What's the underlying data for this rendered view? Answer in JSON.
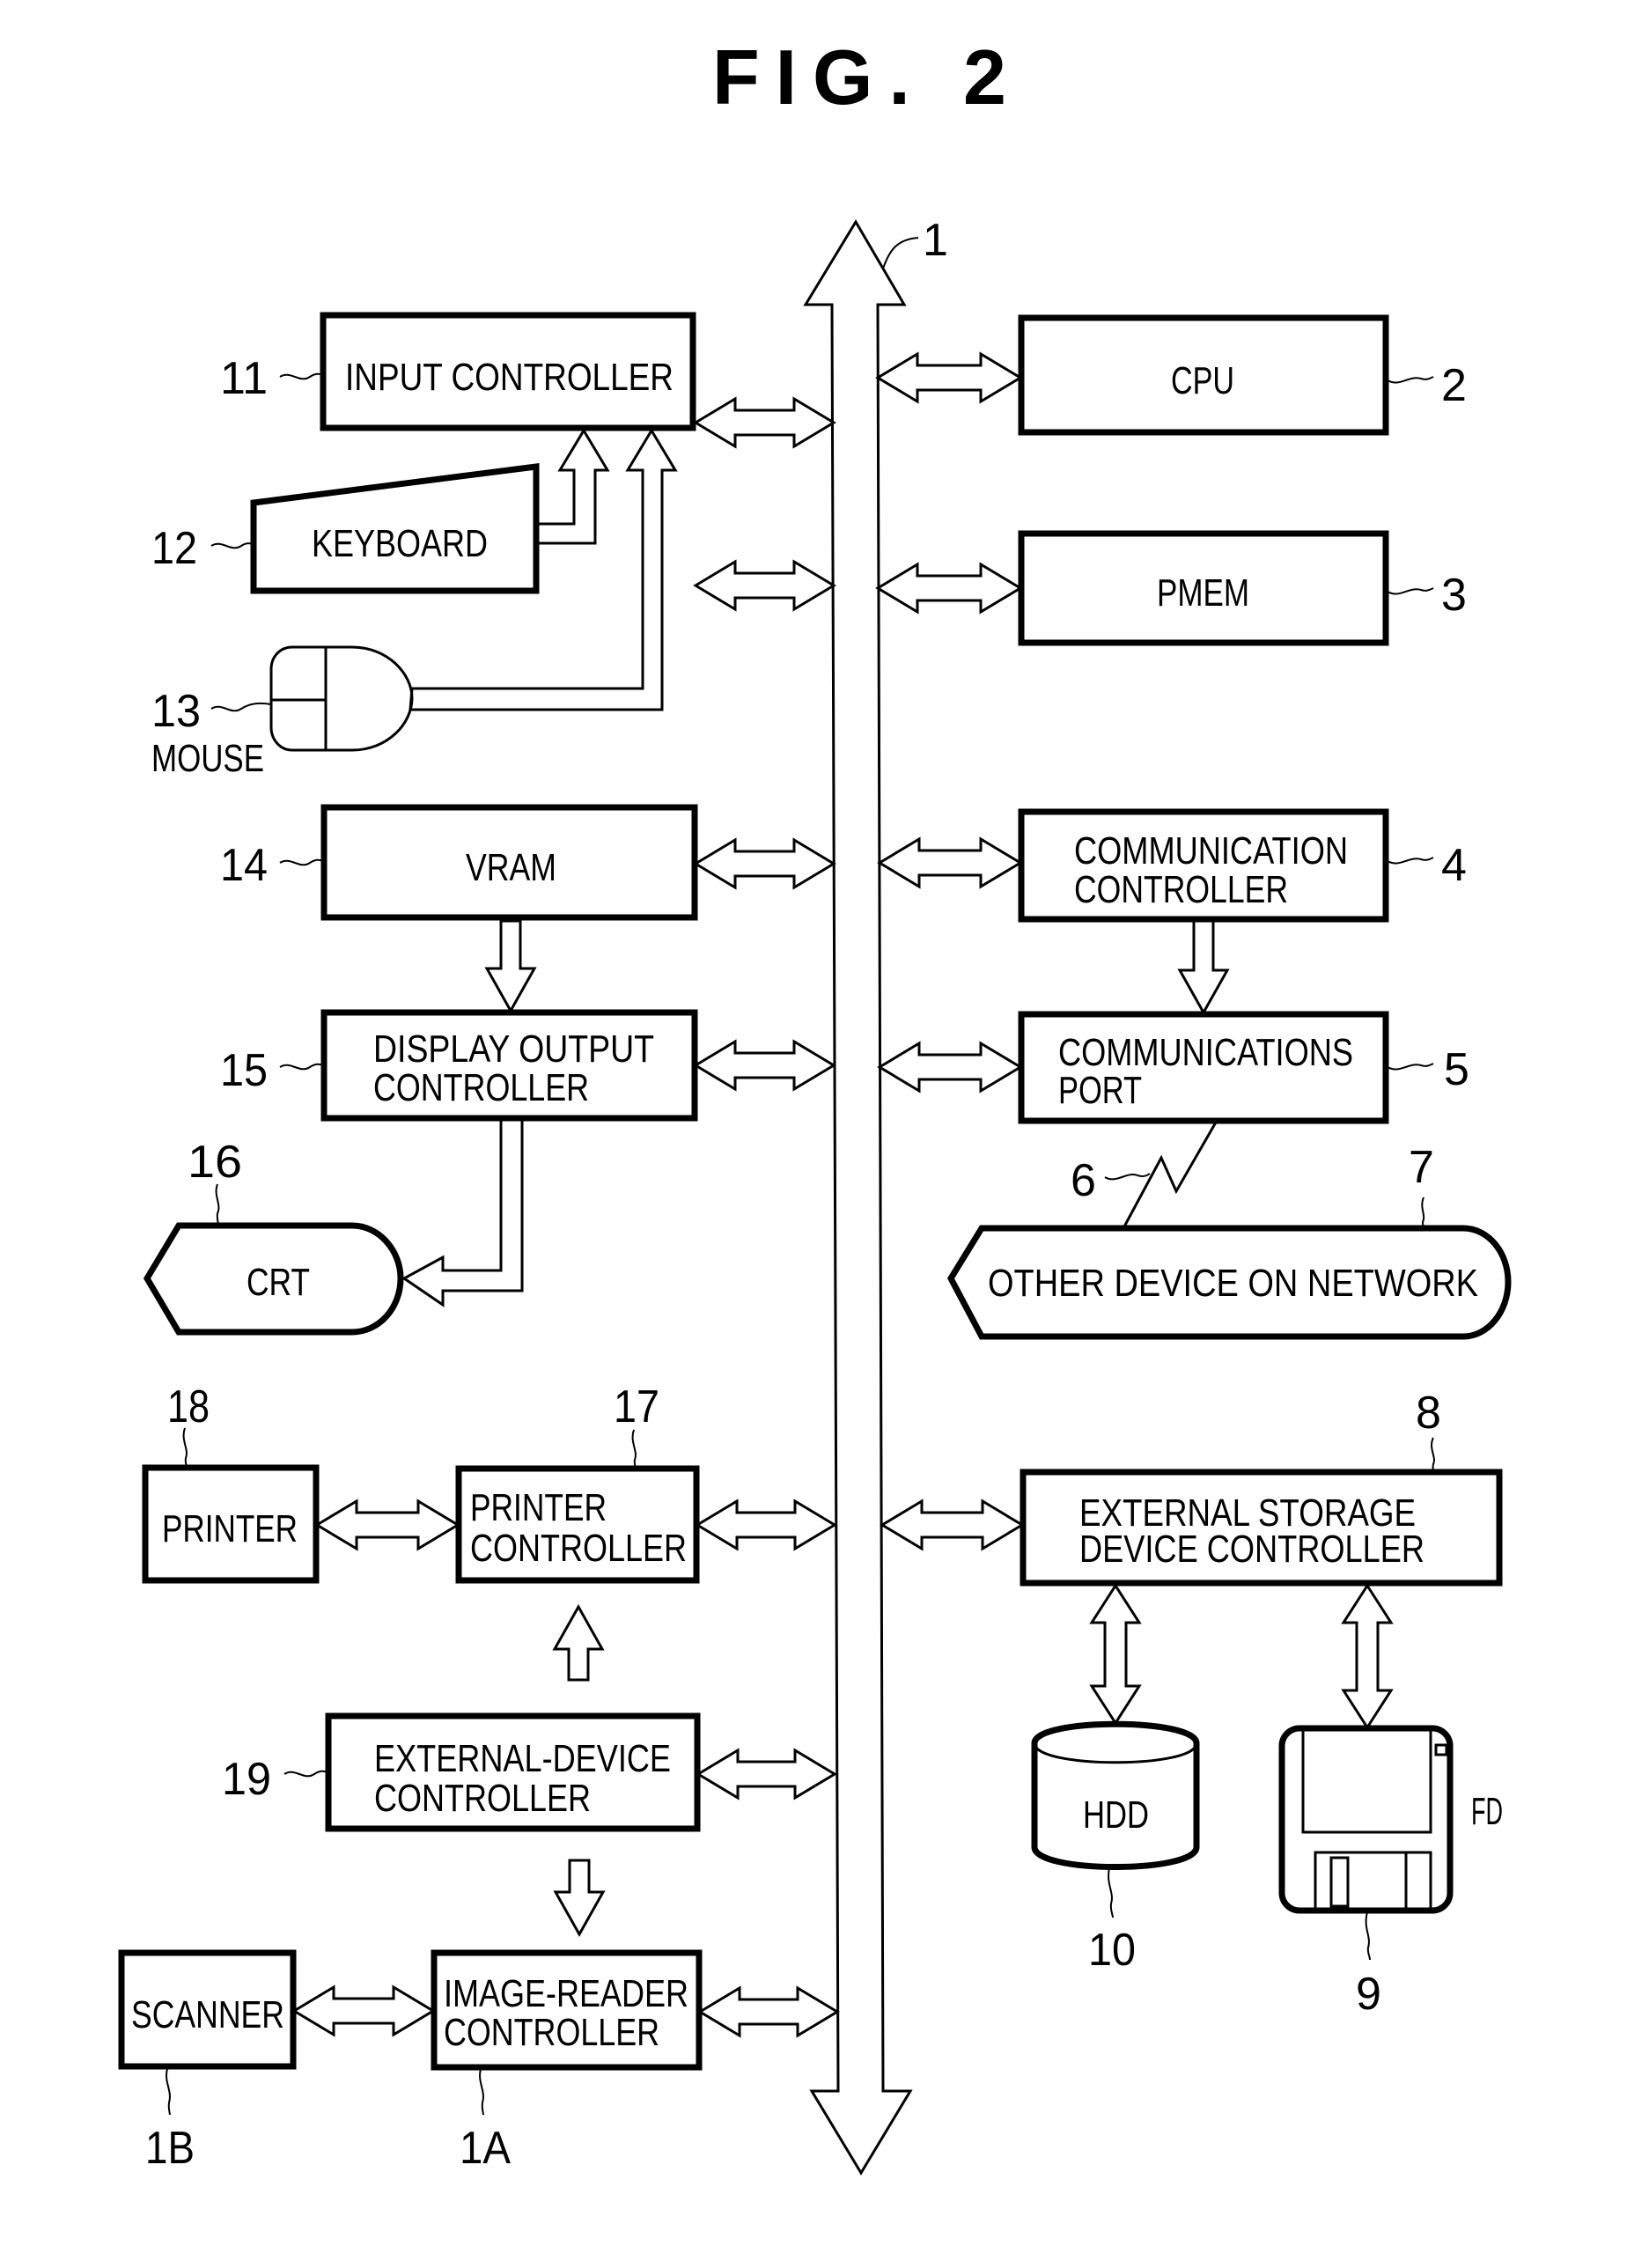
{
  "figure": {
    "title": "FIG. 2",
    "bus_ref": "1"
  },
  "blocks": {
    "input_controller": {
      "label": "INPUT  CONTROLLER",
      "ref": "11"
    },
    "cpu": {
      "label": "CPU",
      "ref": "2"
    },
    "keyboard": {
      "label": "KEYBOARD",
      "ref": "12"
    },
    "pmem": {
      "label": "PMEM",
      "ref": "3"
    },
    "mouse": {
      "label": "MOUSE",
      "ref": "13"
    },
    "vram": {
      "label": "VRAM",
      "ref": "14"
    },
    "communication_controller": {
      "lines": [
        "COMMUNICATION",
        "CONTROLLER"
      ],
      "ref": "4"
    },
    "display_output_controller": {
      "lines": [
        "DISPLAY  OUTPUT",
        "CONTROLLER"
      ],
      "ref": "15"
    },
    "communications_port": {
      "lines": [
        "COMMUNICATIONS",
        "PORT"
      ],
      "ref": "5"
    },
    "network_line": {
      "ref": "6"
    },
    "crt": {
      "label": "CRT",
      "ref": "16"
    },
    "other_device": {
      "label": "OTHER  DEVICE  ON  NETWORK",
      "ref": "7"
    },
    "printer": {
      "label": "PRINTER",
      "ref": "18"
    },
    "printer_controller": {
      "lines": [
        "PRINTER",
        "CONTROLLER"
      ],
      "ref": "17"
    },
    "external_storage_controller": {
      "lines": [
        "EXTERNAL  STORAGE",
        "DEVICE  CONTROLLER"
      ],
      "ref": "8"
    },
    "external_device_controller": {
      "lines": [
        "EXTERNAL-DEVICE",
        "CONTROLLER"
      ],
      "ref": "19"
    },
    "hdd": {
      "label": "HDD",
      "ref": "10"
    },
    "fd": {
      "label": "FD",
      "ref": "9"
    },
    "scanner": {
      "label": "SCANNER",
      "ref": "1B"
    },
    "image_reader_controller": {
      "lines": [
        "IMAGE-READER",
        "CONTROLLER"
      ],
      "ref": "1A"
    }
  }
}
